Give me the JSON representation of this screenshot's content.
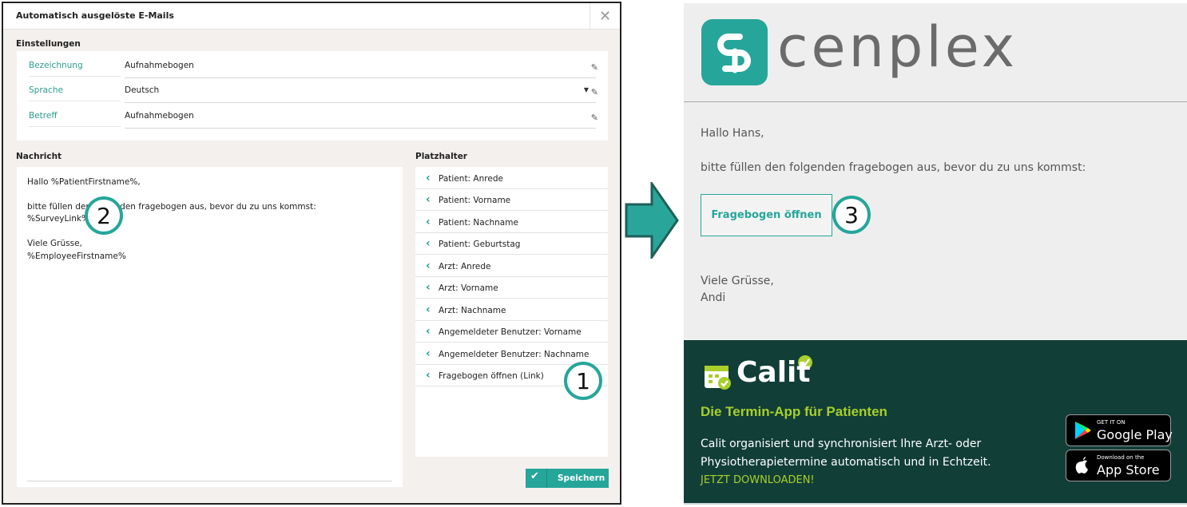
{
  "dialog": {
    "title": "Automatisch ausgelöste E-Mails",
    "close_glyph": "✕",
    "settings_heading": "Einstellungen",
    "settings": [
      {
        "label": "Bezeichnung",
        "value": "Aufnahmebogen"
      },
      {
        "label": "Sprache",
        "value": "Deutsch"
      },
      {
        "label": "Betreff",
        "value": "Aufnahmebogen"
      }
    ],
    "message_heading": "Nachricht",
    "message_lines": [
      "Hallo %PatientFirstname%,",
      "bitte füllen den folgenden fragebogen aus, bevor du zu uns kommst:",
      "%SurveyLink%",
      "Viele Grüsse,",
      "%EmployeeFirstname%"
    ],
    "placeholder_heading": "Platzhalter",
    "placeholders": [
      "Patient: Anrede",
      "Patient: Vorname",
      "Patient: Nachname",
      "Patient: Geburtstag",
      "Arzt: Anrede",
      "Arzt: Vorname",
      "Arzt: Nachname",
      "Angemeldeter Benutzer: Vorname",
      "Angemeldeter Benutzer: Nachname",
      "Fragebogen öffnen (Link)"
    ],
    "save_label": "Speichern"
  },
  "badges": [
    "1",
    "2",
    "3"
  ],
  "email": {
    "logo_text": "cenplex",
    "greeting": "Hallo Hans,",
    "body": "bitte füllen den folgenden fragebogen aus, bevor du zu uns kommst:",
    "button_label": "Fragebogen öffnen",
    "closing": "Viele Grüsse,",
    "signature": "Andi"
  },
  "footer": {
    "brand": "Calit",
    "tagline": "Die Termin-App für Patienten",
    "desc_line1": "Calit organisiert und synchronisiert Ihre Arzt- oder",
    "desc_line2": "Physiotherapietermine automatisch und in Echtzeit.",
    "cta": "JETZT DOWNLOADEN!",
    "google_small": "GET IT ON",
    "google_big": "Google Play",
    "apple_small": "Download on the",
    "apple_big": "App Store"
  },
  "colors": {
    "accent": "#26a69a",
    "footer_bg": "#123e38",
    "footer_highlight": "#a8cf2a"
  }
}
